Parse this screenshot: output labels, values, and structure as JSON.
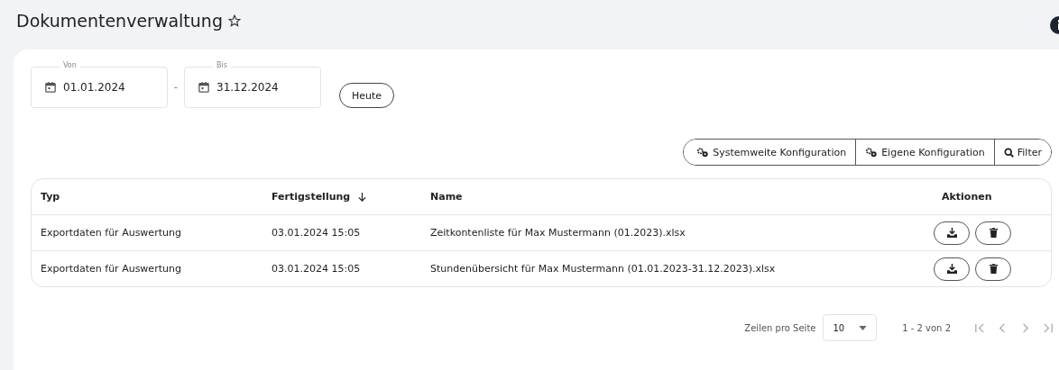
{
  "page": {
    "title": "Dokumentenverwaltung",
    "favorite": false
  },
  "date_range": {
    "from": {
      "label": "Von",
      "value": "01.01.2024"
    },
    "separator": "-",
    "to": {
      "label": "Bis",
      "value": "31.12.2024"
    },
    "today_button": "Heute"
  },
  "toolbar": [
    {
      "kind": "config",
      "label": "Systemweite Konfiguration"
    },
    {
      "kind": "config",
      "label": "Eigene Konfiguration"
    },
    {
      "kind": "filter",
      "label": "Filter"
    }
  ],
  "table": {
    "columns": [
      {
        "label": "Typ",
        "sorted": false
      },
      {
        "label": "Fertigstellung",
        "sorted": true
      },
      {
        "label": "Name",
        "sorted": false
      },
      {
        "label": "Aktionen",
        "sorted": false
      }
    ],
    "rows": [
      {
        "type": "Exportdaten für Auswertung",
        "completed": "03.01.2024 15:05",
        "name": "Zeitkontenliste für Max Mustermann (01.2023).xlsx"
      },
      {
        "type": "Exportdaten für Auswertung",
        "completed": "03.01.2024 15:05",
        "name": "Stundenübersicht für Max Mustermann (01.01.2023-31.12.2023).xlsx"
      }
    ]
  },
  "pagination": {
    "rows_per_page_label": "Zeilen pro Seite",
    "rows_per_page": "10",
    "range": "1 - 2 von 2",
    "buttons": [
      {
        "kind": "first",
        "disabled": true
      },
      {
        "kind": "prev",
        "disabled": true
      },
      {
        "kind": "next",
        "disabled": true
      },
      {
        "kind": "last",
        "disabled": true
      }
    ]
  }
}
